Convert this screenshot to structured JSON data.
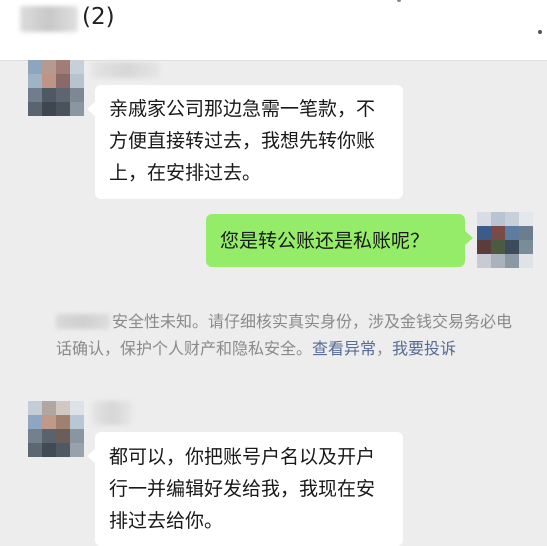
{
  "header": {
    "member_count": "(2)"
  },
  "messages": [
    {
      "side": "left",
      "lines": [
        "亲戚家公司那边急需一笔款，不",
        "方便直接转过去，我想先转你账",
        "上，在安排过去。"
      ]
    },
    {
      "side": "right",
      "lines": [
        "您是转公账还是私账呢？"
      ]
    },
    {
      "side": "left",
      "lines": [
        "都可以，你把账号户名以及开户",
        "行一并编辑好发给我，我现在安",
        "排过去给你。"
      ]
    }
  ],
  "system_notice": {
    "text": "安全性未知。请仔细核实真实身份，涉及金钱交易务必电话确认，保护个人财产和隐私安全。",
    "link_view": "查看异常",
    "separator": "，",
    "link_report": "我要投诉"
  },
  "colors": {
    "background": "#ededed",
    "bubble_received": "#ffffff",
    "bubble_sent": "#95ec69",
    "link": "#576b95",
    "system_text": "#8a8a8a"
  }
}
